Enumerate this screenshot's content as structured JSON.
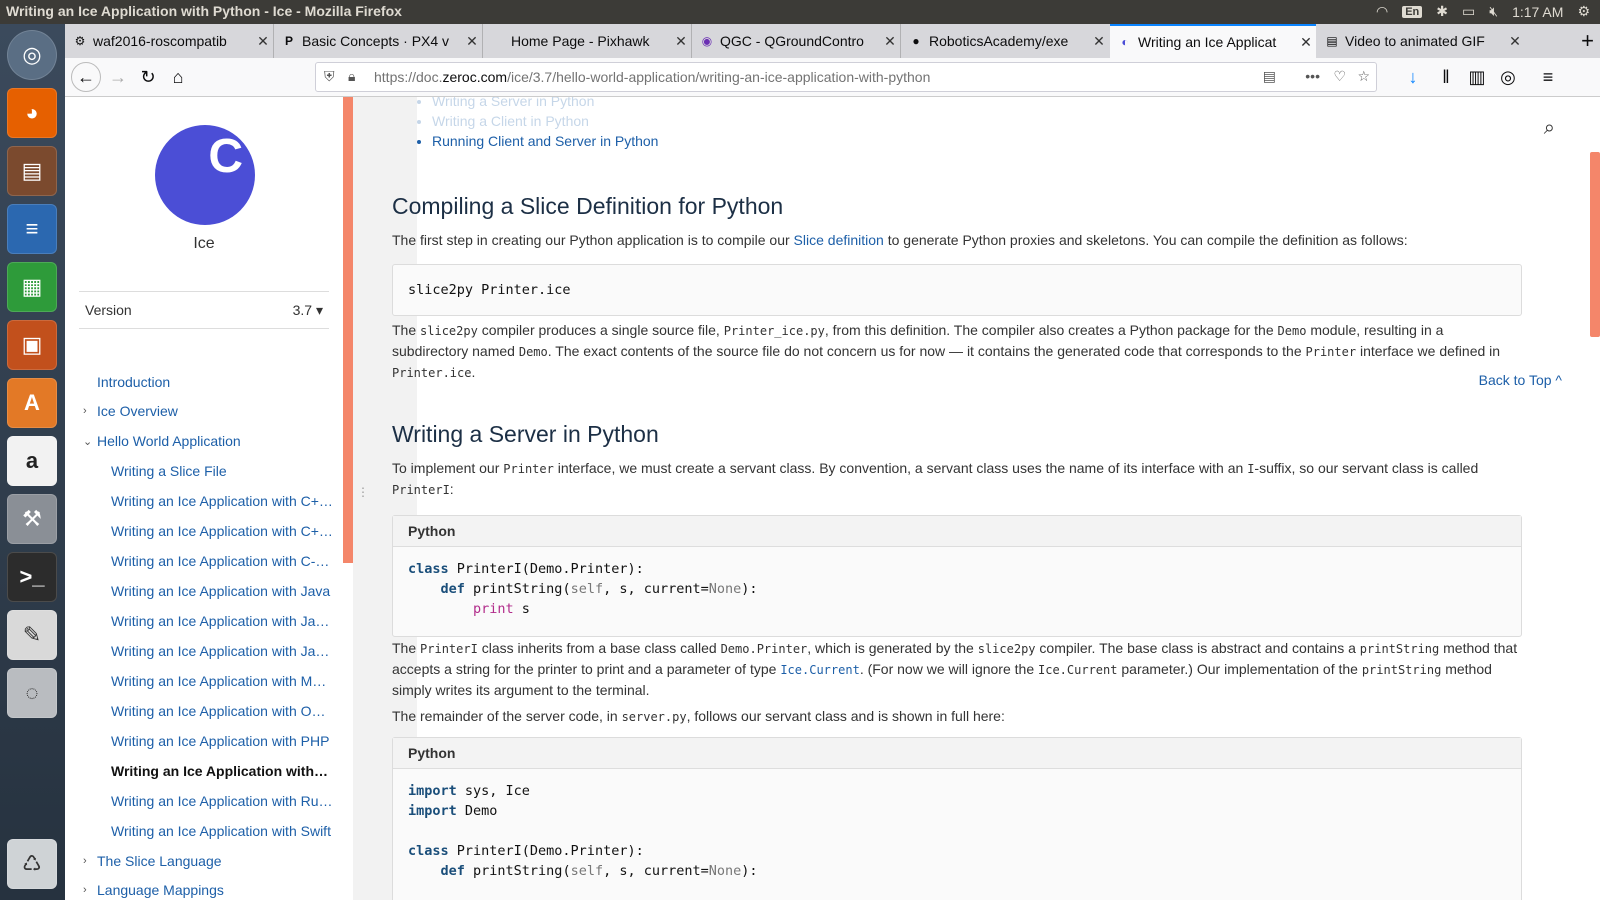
{
  "os": {
    "window_title": "Writing an Ice Application with Python - Ice - Mozilla Firefox",
    "lang": "En",
    "clock": "1:17 AM"
  },
  "tabs": [
    {
      "title": "waf2016-roscompatib",
      "icon": "gear"
    },
    {
      "title": "Basic Concepts · PX4 v",
      "icon": "P"
    },
    {
      "title": "Home Page - Pixhawk",
      "icon": ""
    },
    {
      "title": "QGC - QGroundContro",
      "icon": "Q"
    },
    {
      "title": "RoboticsAcademy/exe",
      "icon": "github"
    },
    {
      "title": "Writing an Ice Applicat",
      "icon": "zeroc"
    },
    {
      "title": "Video to animated GIF",
      "icon": "doc"
    }
  ],
  "url": {
    "prefix": "https://doc.",
    "domain": "zeroc.com",
    "path": "/ice/3.7/hello-world-application/writing-an-ice-application-with-python"
  },
  "sidebar": {
    "logo_letter": "C",
    "title": "Ice",
    "version_label": "Version",
    "version_value": "3.7",
    "items": [
      {
        "label": "Introduction"
      },
      {
        "label": "Ice Overview"
      },
      {
        "label": "Hello World Application"
      },
      {
        "label": "Writing a Slice File"
      },
      {
        "label": "Writing an Ice Application with C+…"
      },
      {
        "label": "Writing an Ice Application with C+…"
      },
      {
        "label": "Writing an Ice Application with C-…"
      },
      {
        "label": "Writing an Ice Application with Java"
      },
      {
        "label": "Writing an Ice Application with Ja…"
      },
      {
        "label": "Writing an Ice Application with Ja…"
      },
      {
        "label": "Writing an Ice Application with MA…"
      },
      {
        "label": "Writing an Ice Application with Ob…"
      },
      {
        "label": "Writing an Ice Application with PHP"
      },
      {
        "label": "Writing an Ice Application with…"
      },
      {
        "label": "Writing an Ice Application with Ruby"
      },
      {
        "label": "Writing an Ice Application with Swift"
      },
      {
        "label": "The Slice Language"
      },
      {
        "label": "Language Mappings"
      }
    ]
  },
  "content": {
    "toc": [
      "Writing a Server in Python",
      "Writing a Client in Python",
      "Running Client and Server in Python"
    ],
    "h_compile": "Compiling a Slice Definition for Python",
    "p1_a": "The first step in creating our Python application is to compile our ",
    "p1_link": "Slice definition",
    "p1_b": " to generate Python proxies and skeletons. You can compile the definition as follows:",
    "code1": "slice2py Printer.ice",
    "p2": [
      {
        "t": "The "
      },
      {
        "c": "slice2py"
      },
      {
        "t": " compiler produces a single source file, "
      },
      {
        "c": "Printer_ice.py"
      },
      {
        "t": ", from this definition. The compiler also creates a Python package for the "
      },
      {
        "c": "Demo"
      },
      {
        "t": " module, resulting in a subdirectory named "
      },
      {
        "c": "Demo"
      },
      {
        "t": ". The exact contents of the source file do not concern us for now — it contains the generated code that corresponds to the "
      },
      {
        "c": "Printer"
      },
      {
        "t": " interface we defined in "
      },
      {
        "c": "Printer.ice"
      },
      {
        "t": "."
      }
    ],
    "back_to_top": "Back to Top ^",
    "h_server": "Writing a Server in Python",
    "p3": [
      {
        "t": "To implement our "
      },
      {
        "c": "Printer"
      },
      {
        "t": " interface, we must create a servant class. By convention, a servant class uses the name of its interface with an "
      },
      {
        "c": "I"
      },
      {
        "t": "-suffix, so our servant class is called "
      },
      {
        "c": "PrinterI"
      },
      {
        "t": ":"
      }
    ],
    "code_lang": "Python",
    "p4": [
      {
        "t": "The "
      },
      {
        "c": "PrinterI"
      },
      {
        "t": " class inherits from a base class called "
      },
      {
        "c": "Demo.Printer"
      },
      {
        "t": ", which is generated by the "
      },
      {
        "c": "slice2py"
      },
      {
        "t": " compiler. The base class is abstract and contains a "
      },
      {
        "c": "printString"
      },
      {
        "t": " method that accepts a string for the printer to print and a parameter of type "
      },
      {
        "cl": "Ice.Current"
      },
      {
        "t": ". (For now we will ignore the "
      },
      {
        "c": "Ice.Current"
      },
      {
        "t": " parameter.) Our implementation of the "
      },
      {
        "c": "printString"
      },
      {
        "t": " method simply writes its argument to the terminal."
      }
    ],
    "p5": [
      {
        "t": "The remainder of the server code, in "
      },
      {
        "c": "server.py"
      },
      {
        "t": ", follows our servant class and is shown in full here:"
      }
    ]
  }
}
